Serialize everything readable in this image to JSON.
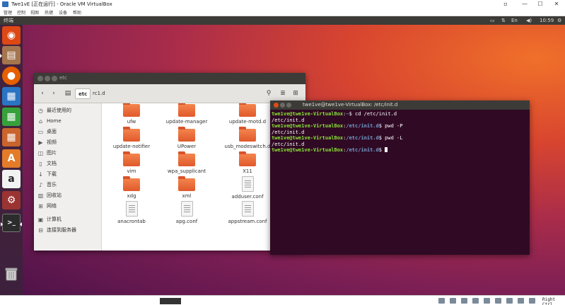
{
  "host": {
    "title": "Twe1vE [正在运行] - Oracle VM VirtualBox",
    "menu": [
      "管理",
      "控制",
      "视图",
      "热键",
      "设备",
      "帮助"
    ],
    "status": {
      "host_key": "Right Ctrl"
    }
  },
  "guest": {
    "topbar": {
      "app_title": "终端",
      "time": "10:59"
    },
    "launcher": [
      {
        "name": "ubuntu-dash",
        "color": "#dd4814",
        "glyph": "◉"
      },
      {
        "name": "files",
        "color": "#a5754e",
        "glyph": "▤"
      },
      {
        "name": "firefox",
        "color": "#e66000",
        "glyph": "●"
      },
      {
        "name": "libreoffice-writer",
        "color": "#2a74c4",
        "glyph": "▦"
      },
      {
        "name": "libreoffice-calc",
        "color": "#36a13b",
        "glyph": "▦"
      },
      {
        "name": "libreoffice-impress",
        "color": "#c8642c",
        "glyph": "▦"
      },
      {
        "name": "software-center",
        "color": "#e47b28",
        "glyph": "A"
      },
      {
        "name": "amazon",
        "color": "#f2f2f2",
        "glyph": "a"
      },
      {
        "name": "settings",
        "color": "#9a3432",
        "glyph": "⚙"
      },
      {
        "name": "terminal",
        "color": "#2c2c2c",
        "glyph": ">_"
      }
    ],
    "file_manager": {
      "title": "etc",
      "breadcrumbs": [
        "etc",
        "rc1.d"
      ],
      "sidebar": [
        {
          "icon": "clock-icon",
          "glyph": "◷",
          "label": "最近使用的"
        },
        {
          "icon": "home-icon",
          "glyph": "⌂",
          "label": "Home"
        },
        {
          "icon": "desktop-icon",
          "glyph": "▭",
          "label": "桌面"
        },
        {
          "icon": "video-icon",
          "glyph": "▶",
          "label": "视频"
        },
        {
          "icon": "picture-icon",
          "glyph": "◫",
          "label": "图片"
        },
        {
          "icon": "document-icon",
          "glyph": "▯",
          "label": "文档"
        },
        {
          "icon": "download-icon",
          "glyph": "↓",
          "label": "下载"
        },
        {
          "icon": "music-icon",
          "glyph": "♪",
          "label": "音乐"
        },
        {
          "icon": "trash-icon",
          "glyph": "▥",
          "label": "回收站"
        },
        {
          "icon": "network-icon",
          "glyph": "⊞",
          "label": "网络"
        },
        {
          "icon": "computer-icon",
          "glyph": "▣",
          "label": "计算机"
        },
        {
          "icon": "server-icon",
          "glyph": "⊟",
          "label": "连接到服务器"
        }
      ],
      "files": [
        {
          "name": "ufw",
          "type": "folder"
        },
        {
          "name": "update-manager",
          "type": "folder"
        },
        {
          "name": "update-motd.d",
          "type": "folder"
        },
        {
          "name": "update-notifier",
          "type": "folder"
        },
        {
          "name": "UPower",
          "type": "folder"
        },
        {
          "name": "usb_modeswitch.d",
          "type": "folder"
        },
        {
          "name": "vim",
          "type": "folder"
        },
        {
          "name": "wpa_supplicant",
          "type": "folder"
        },
        {
          "name": "X11",
          "type": "folder"
        },
        {
          "name": "xdg",
          "type": "folder"
        },
        {
          "name": "xml",
          "type": "folder"
        },
        {
          "name": "adduser.conf",
          "type": "doc"
        },
        {
          "name": "anacrontab",
          "type": "doc"
        },
        {
          "name": "apg.conf",
          "type": "doc"
        },
        {
          "name": "appstream.conf",
          "type": "doc"
        }
      ]
    },
    "terminal": {
      "title": "twe1ve@twe1ve-VirtualBox: /etc/init.d",
      "lines": [
        {
          "user": "twe1ve@twe1ve-VirtualBox",
          "path": "~",
          "cmd": " cd /etc/init.d"
        },
        {
          "output": "/etc/init.d"
        },
        {
          "user": "twe1ve@twe1ve-VirtualBox",
          "path": "/etc/init.d",
          "cmd": " pwd -P"
        },
        {
          "output": "/etc/init.d"
        },
        {
          "user": "twe1ve@twe1ve-VirtualBox",
          "path": "/etc/init.d",
          "cmd": " pwd -L"
        },
        {
          "output": "/etc/init.d"
        },
        {
          "user": "twe1ve@twe1ve-VirtualBox",
          "path": "/etc/init.d",
          "cmd": " ",
          "cursor": true
        }
      ]
    }
  }
}
